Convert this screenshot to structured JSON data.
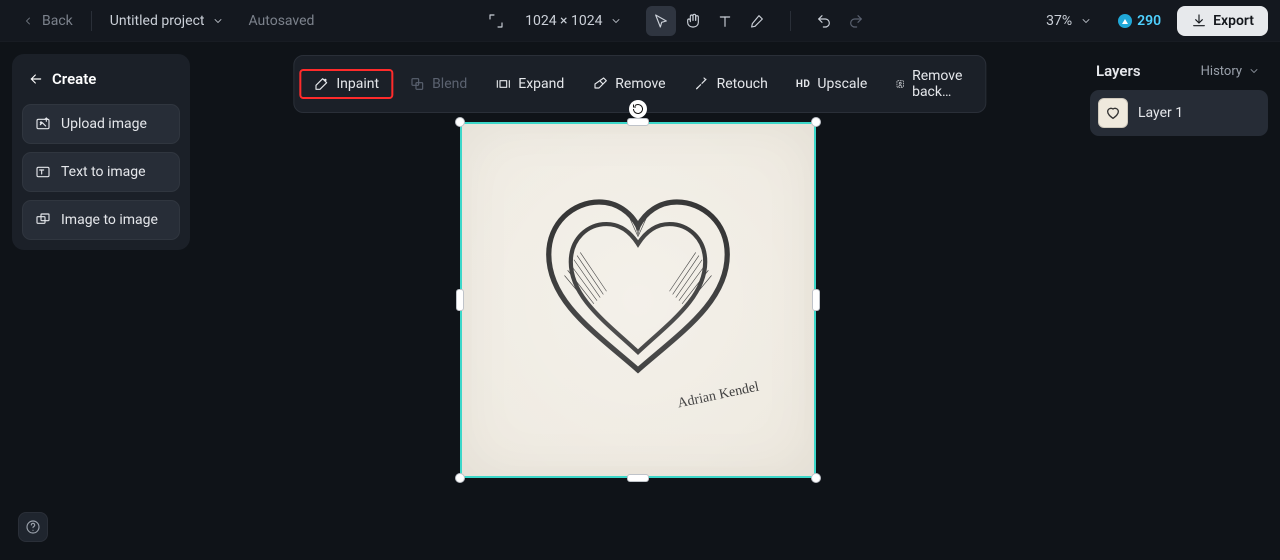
{
  "topbar": {
    "back": "Back",
    "project_name": "Untitled project",
    "autosaved": "Autosaved",
    "canvas_size": "1024 × 1024",
    "zoom": "37%",
    "credits": "290",
    "export": "Export"
  },
  "create_panel": {
    "title": "Create",
    "upload": "Upload image",
    "text2img": "Text to image",
    "img2img": "Image to image"
  },
  "context_bar": {
    "inpaint": "Inpaint",
    "blend": "Blend",
    "expand": "Expand",
    "remove": "Remove",
    "retouch": "Retouch",
    "upscale": "Upscale",
    "upscale_prefix": "HD",
    "remove_bg": "Remove back…"
  },
  "layers_panel": {
    "title": "Layers",
    "history": "History",
    "layer1": "Layer 1"
  },
  "canvas": {
    "signature": "Adrian Kendel"
  }
}
